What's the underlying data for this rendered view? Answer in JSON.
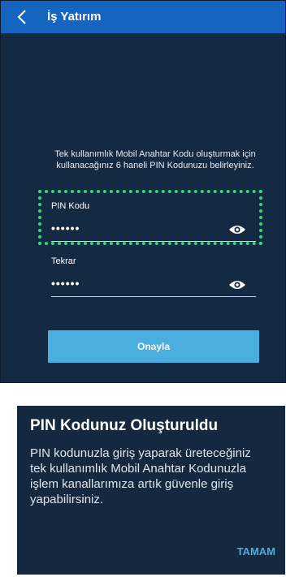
{
  "app": {
    "title": "İş Yatırım"
  },
  "pin_setup": {
    "info_text": "Tek kullanımlık Mobil Anahtar Kodu oluşturmak için kullanacağınız 6 haneli PIN Kodunuzu belirleyiniz.",
    "pin_label": "PIN Kodu",
    "pin_value": "••••••",
    "repeat_label": "Tekrar",
    "repeat_value": "••••••",
    "confirm_label": "Onayla"
  },
  "dialog": {
    "title": "PIN Kodunuz Oluşturuldu",
    "message": "PIN kodunuzla giriş yaparak üreteceğiniz tek kullanımlık Mobil Anahtar Kodunuzla işlem kanallarımıza artık güvenle giriş yapabilirsiniz.",
    "ok_label": "TAMAM"
  },
  "colors": {
    "appbar": "#1565c0",
    "background": "#142942",
    "button": "#4aaede",
    "highlight": "#22e07a"
  },
  "icons": {
    "back": "chevron-left-icon",
    "show_password": "eye-icon"
  }
}
